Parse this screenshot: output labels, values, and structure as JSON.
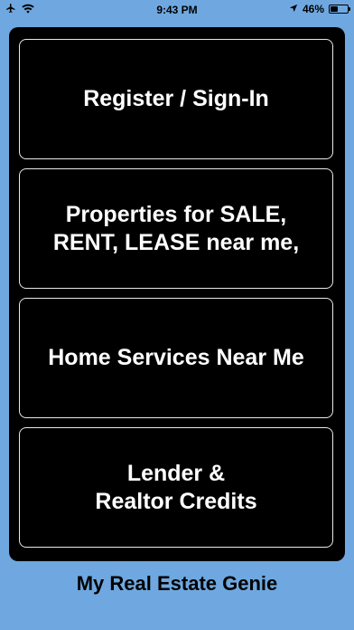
{
  "status_bar": {
    "time": "9:43 PM",
    "battery_percent_label": "46%",
    "battery_level": 0.46,
    "icons": [
      "airplane-icon",
      "wifi-icon",
      "location-arrow-icon",
      "battery-icon"
    ]
  },
  "menu": {
    "items": [
      {
        "label": "Register / Sign-In"
      },
      {
        "label": "Properties for SALE,\nRENT, LEASE near me,"
      },
      {
        "label": "Home Services Near Me"
      },
      {
        "label": "Lender &\nRealtor Credits"
      }
    ]
  },
  "footer": {
    "title": "My Real Estate Genie"
  },
  "colors": {
    "background": "#6FA8E0",
    "panel": "#000000",
    "button_border": "#e8e8e8",
    "button_text": "#ffffff"
  }
}
